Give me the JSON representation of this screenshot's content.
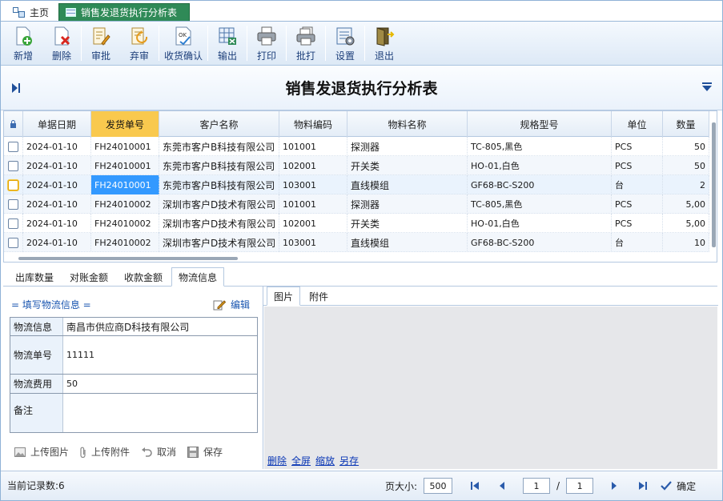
{
  "tabs": {
    "home": "主页",
    "active": "销售发退货执行分析表"
  },
  "toolbar": [
    {
      "label": "新增",
      "icon": "add-doc-icon"
    },
    {
      "label": "删除",
      "icon": "delete-doc-icon"
    },
    {
      "label": "审批",
      "icon": "approve-icon"
    },
    {
      "label": "弃审",
      "icon": "unapprove-icon"
    },
    {
      "label": "收货确认",
      "icon": "receipt-confirm-icon"
    },
    {
      "label": "输出",
      "icon": "export-icon"
    },
    {
      "label": "打印",
      "icon": "print-icon"
    },
    {
      "label": "批打",
      "icon": "batch-print-icon"
    },
    {
      "label": "设置",
      "icon": "settings-icon"
    },
    {
      "label": "退出",
      "icon": "exit-icon"
    }
  ],
  "title": "销售发退货执行分析表",
  "grid": {
    "headers": [
      "单据日期",
      "发货单号",
      "客户名称",
      "物料编码",
      "物料名称",
      "规格型号",
      "单位",
      "数量"
    ],
    "rows": [
      [
        "2024-01-10",
        "FH24010001",
        "东莞市客户B科技有限公司",
        "101001",
        "探测器",
        "TC-805,黑色",
        "PCS",
        "50"
      ],
      [
        "2024-01-10",
        "FH24010001",
        "东莞市客户B科技有限公司",
        "102001",
        "开关类",
        "HO-01,白色",
        "PCS",
        "50"
      ],
      [
        "2024-01-10",
        "FH24010001",
        "东莞市客户B科技有限公司",
        "103001",
        "直线模组",
        "GF68-BC-S200",
        "台",
        "2"
      ],
      [
        "2024-01-10",
        "FH24010002",
        "深圳市客户D技术有限公司",
        "101001",
        "探测器",
        "TC-805,黑色",
        "PCS",
        "5,00"
      ],
      [
        "2024-01-10",
        "FH24010002",
        "深圳市客户D技术有限公司",
        "102001",
        "开关类",
        "HO-01,白色",
        "PCS",
        "5,00"
      ],
      [
        "2024-01-10",
        "FH24010002",
        "深圳市客户D技术有限公司",
        "103001",
        "直线模组",
        "GF68-BC-S200",
        "台",
        "10"
      ]
    ]
  },
  "lower_tabs": [
    "出库数量",
    "对账金额",
    "收款金额",
    "物流信息"
  ],
  "logistics": {
    "section_title": "= 填写物流信息 =",
    "edit_label": "编辑",
    "fields": [
      {
        "label": "物流信息",
        "value": "南昌市供应商D科技有限公司"
      },
      {
        "label": "物流单号",
        "value": "11111"
      },
      {
        "label": "物流费用",
        "value": "50"
      },
      {
        "label": "备注",
        "value": ""
      }
    ],
    "actions": [
      "上传图片",
      "上传附件",
      "取消",
      "保存"
    ]
  },
  "attach_tabs": [
    "图片",
    "附件"
  ],
  "image_links": [
    "删除",
    "全屏",
    "缩放",
    "另存"
  ],
  "status": {
    "record_count": "当前记录数:6",
    "page_size_label": "页大小:",
    "page_size": "500",
    "current_page": "1",
    "page_sep": "/",
    "total_pages": "1",
    "confirm_label": "确定"
  }
}
